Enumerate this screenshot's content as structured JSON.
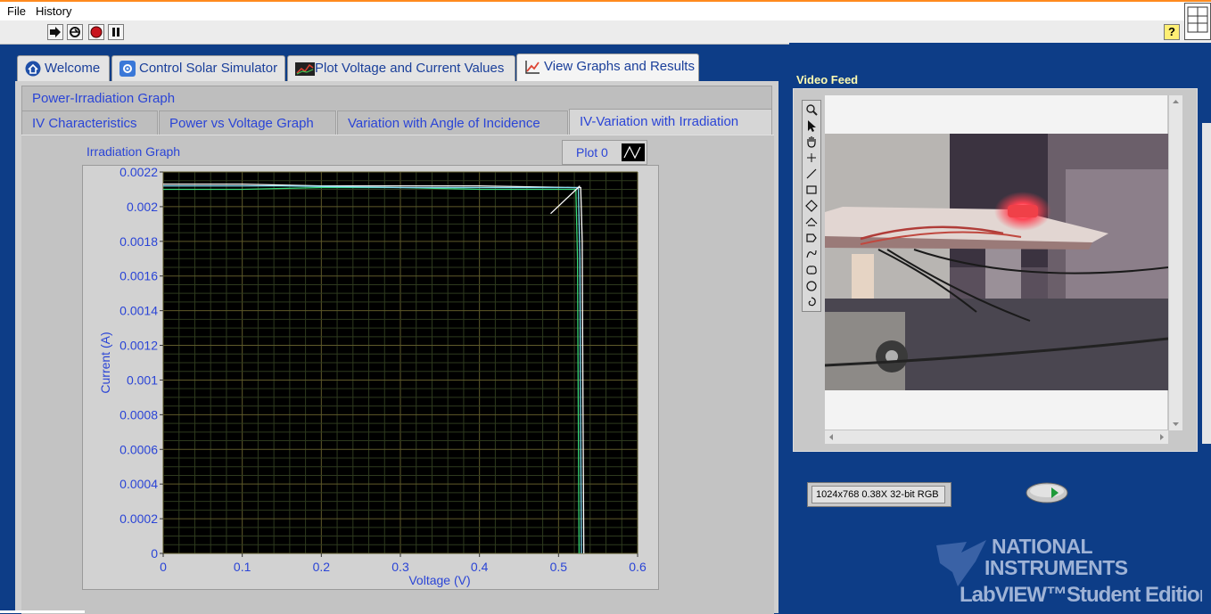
{
  "menu": {
    "file": "File",
    "history": "History"
  },
  "help_label": "?",
  "main_tabs": [
    {
      "label": "Welcome",
      "icon": "home-icon"
    },
    {
      "label": "Control Solar Simulator",
      "icon": "gear-icon"
    },
    {
      "label": "Plot Voltage and Current Values",
      "icon": "chart-icon"
    },
    {
      "label": "View Graphs and Results",
      "icon": "graph-icon",
      "active": true
    }
  ],
  "sub_tabs": {
    "row1": [
      "Power-Irradiation Graph"
    ],
    "row2": [
      "IV Characteristics",
      "Power vs Voltage Graph",
      "Variation with Angle of Incidence",
      "IV-Variation with Irradiation"
    ],
    "active": "IV-Variation with Irradiation"
  },
  "graph": {
    "title": "Irradiation Graph",
    "legend_label": "Plot 0"
  },
  "chart_data": {
    "type": "line",
    "xlabel": "Voltage (V)",
    "ylabel": "Current (A)",
    "xlim": [
      0,
      0.6
    ],
    "ylim": [
      0,
      0.0022
    ],
    "x_ticks": [
      "0",
      "0.1",
      "0.2",
      "0.3",
      "0.4",
      "0.5",
      "0.6"
    ],
    "y_ticks": [
      "0",
      "0.0002",
      "0.0004",
      "0.0006",
      "0.0008",
      "0.001",
      "0.0012",
      "0.0014",
      "0.0016",
      "0.0018",
      "0.002",
      "0.0022"
    ],
    "grid": true,
    "legend_position": "top-right",
    "background": "#000000",
    "series": [
      {
        "color": "#ffffff",
        "points": [
          [
            0,
            0.00213
          ],
          [
            0.1,
            0.00213
          ],
          [
            0.2,
            0.00212
          ],
          [
            0.3,
            0.00212
          ],
          [
            0.4,
            0.00212
          ],
          [
            0.52,
            0.00211
          ],
          [
            0.528,
            0.00211
          ],
          [
            0.53,
            0.0018
          ],
          [
            0.531,
            0.0008
          ],
          [
            0.532,
            0
          ]
        ]
      },
      {
        "color": "#38d878",
        "points": [
          [
            0,
            0.0021
          ],
          [
            0.1,
            0.0021
          ],
          [
            0.2,
            0.00211
          ],
          [
            0.3,
            0.00211
          ],
          [
            0.4,
            0.0021
          ],
          [
            0.5,
            0.0021
          ],
          [
            0.522,
            0.0021
          ],
          [
            0.524,
            0.0017
          ],
          [
            0.525,
            0.0008
          ],
          [
            0.526,
            0
          ]
        ]
      },
      {
        "color": "#7fd8f0",
        "points": [
          [
            0,
            0.00212
          ],
          [
            0.15,
            0.00212
          ],
          [
            0.3,
            0.00211
          ],
          [
            0.45,
            0.00211
          ],
          [
            0.525,
            0.00211
          ],
          [
            0.527,
            0.0017
          ],
          [
            0.528,
            0.0007
          ],
          [
            0.529,
            0
          ]
        ]
      },
      {
        "color": "#ffffff",
        "points": [
          [
            0.49,
            0.00196
          ],
          [
            0.527,
            0.00212
          ]
        ]
      }
    ]
  },
  "video": {
    "label": "Video Feed",
    "image_info": "1024x768 0.38X 32-bit RGB"
  },
  "branding": {
    "line1": "NATIONAL",
    "line2": "INSTRUMENTS",
    "line3": "LabVIEW™Student Edition"
  }
}
